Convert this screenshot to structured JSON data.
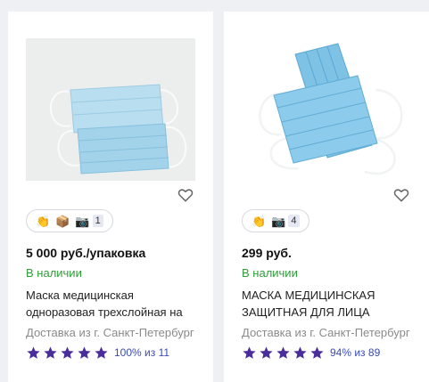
{
  "colors": {
    "stock_green": "#2e9d36",
    "star_purple": "#4a2d9c",
    "rating_link_blue": "#3a4ab8",
    "mask_blue": "#9fd0ea"
  },
  "products": [
    {
      "price": "5 000 руб./упаковка",
      "availability": "В наличии",
      "title": "Маска медицинская одноразовая трехслойная на",
      "delivery": "Доставка из г. Санкт-Петербург",
      "badges": [
        "clapping-hands-icon",
        "box-icon",
        "camera-icon"
      ],
      "photo_count": "1",
      "rating_text": "100% из 11",
      "rating_stars": 5
    },
    {
      "price": "299 руб.",
      "availability": "В наличии",
      "title": "МАСКА МЕДИЦИНСКАЯ ЗАЩИТНАЯ ДЛЯ ЛИЦА",
      "delivery": "Доставка из г. Санкт-Петербург",
      "badges": [
        "clapping-hands-icon",
        "camera-icon"
      ],
      "photo_count": "4",
      "rating_text": "94% из 89",
      "rating_stars": 5
    }
  ]
}
